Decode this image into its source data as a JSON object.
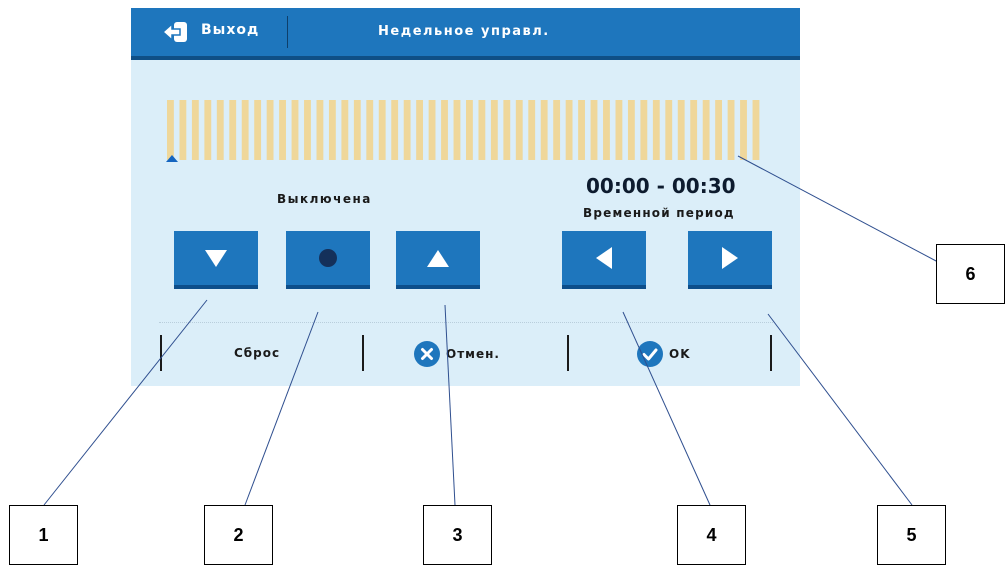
{
  "header": {
    "exit_label": "Выход",
    "title": "Недельное управл.",
    "bg_color": "#1e76bd"
  },
  "schedule": {
    "segments": 48,
    "segment_color": "#efd79a",
    "marker_color": "#1565c0"
  },
  "status": {
    "label": "Выключена"
  },
  "period": {
    "time_range": "00:00 - 00:30",
    "label": "Временной период"
  },
  "buttons": [
    {
      "name": "decrease-button",
      "icon": "triangle-down-icon"
    },
    {
      "name": "off-button",
      "icon": "dot-icon"
    },
    {
      "name": "increase-button",
      "icon": "triangle-up-icon"
    },
    {
      "name": "previous-period-button",
      "icon": "triangle-left-icon"
    },
    {
      "name": "next-period-button",
      "icon": "triangle-right-icon"
    }
  ],
  "bottom": {
    "reset_label": "Сброс",
    "cancel_label": "Отмен.",
    "ok_label": "OK"
  },
  "callouts": [
    "1",
    "2",
    "3",
    "4",
    "5",
    "6"
  ]
}
